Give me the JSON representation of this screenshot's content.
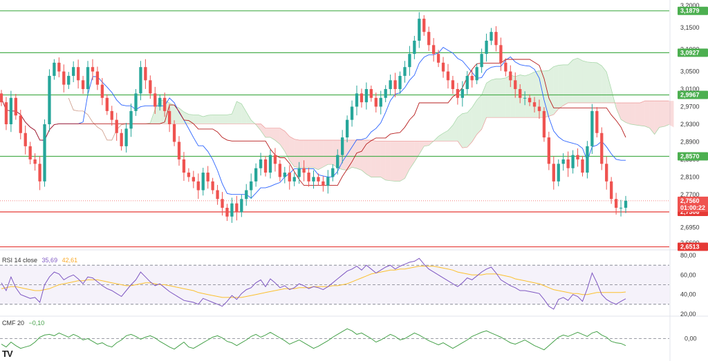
{
  "chart_data": [
    {
      "type": "candlestick",
      "title": "",
      "ylim": [
        2.66,
        3.2
      ],
      "yaxis_ticks": [
        "3,2000",
        "3,1500",
        "3,1000",
        "3,0500",
        "3,0100",
        "2,9700",
        "2,9300",
        "2,8900",
        "2,8500",
        "2,8100",
        "2,7700",
        "2,7300",
        "2,6950",
        "2,6600"
      ],
      "yaxis_tick_values": [
        3.2,
        3.15,
        3.1,
        3.05,
        3.01,
        2.97,
        2.93,
        2.89,
        2.85,
        2.81,
        2.77,
        2.73,
        2.695,
        2.66
      ],
      "horizontal_levels": [
        {
          "value": 3.1879,
          "label": "3,1879",
          "color": "#4caf50"
        },
        {
          "value": 3.0927,
          "label": "3,0927",
          "color": "#4caf50"
        },
        {
          "value": 2.9967,
          "label": "2,9967",
          "color": "#4caf50"
        },
        {
          "value": 2.857,
          "label": "2,8570",
          "color": "#4caf50"
        },
        {
          "value": 2.7306,
          "label": "2,7306",
          "color": "#e53935"
        },
        {
          "value": 2.6513,
          "label": "2,6513",
          "color": "#e53935"
        }
      ],
      "current_price": {
        "value": 2.756,
        "label": "2,7560",
        "countdown": "01:00:22"
      },
      "colors": {
        "up": "#26a69a",
        "down": "#ef5350",
        "tenkan": "#2962ff",
        "kijun": "#b71c1c",
        "kumo_bull": "#a5d6a7",
        "kumo_bear": "#ef9a9a"
      },
      "closes": [
        2.98,
        2.93,
        2.99,
        2.95,
        2.91,
        2.88,
        2.85,
        2.84,
        2.8,
        2.93,
        3.04,
        3.07,
        3.05,
        3.02,
        3.04,
        3.06,
        3.03,
        3.01,
        3.06,
        3.05,
        3.02,
        2.99,
        2.96,
        2.94,
        2.91,
        2.88,
        2.92,
        2.96,
        3.0,
        3.06,
        3.03,
        3.0,
        2.97,
        2.99,
        2.96,
        2.93,
        2.89,
        2.85,
        2.82,
        2.81,
        2.8,
        2.78,
        2.82,
        2.8,
        2.78,
        2.76,
        2.74,
        2.72,
        2.75,
        2.73,
        2.76,
        2.78,
        2.8,
        2.83,
        2.85,
        2.82,
        2.86,
        2.84,
        2.81,
        2.82,
        2.8,
        2.81,
        2.83,
        2.82,
        2.8,
        2.81,
        2.8,
        2.79,
        2.81,
        2.83,
        2.86,
        2.9,
        2.94,
        2.97,
        3.0,
        2.98,
        3.01,
        2.99,
        2.97,
        2.99,
        3.01,
        3.03,
        3.01,
        3.04,
        3.06,
        3.09,
        3.12,
        3.17,
        3.14,
        3.11,
        3.09,
        3.07,
        3.05,
        3.03,
        3.01,
        2.99,
        3.01,
        3.04,
        3.03,
        3.06,
        3.09,
        3.12,
        3.14,
        3.11,
        3.07,
        3.05,
        3.03,
        3.01,
        2.99,
        2.99,
        2.98,
        2.97,
        2.96,
        2.9,
        2.84,
        2.8,
        2.84,
        2.85,
        2.83,
        2.86,
        2.85,
        2.82,
        2.88,
        2.96,
        2.91,
        2.84,
        2.8,
        2.76,
        2.74,
        2.74,
        2.756
      ],
      "rsi": {
        "label": "RSI 14 close",
        "value_label": "35,69",
        "ma_label": "42,61",
        "ylim": [
          20,
          80
        ],
        "ticks": [
          "80,00",
          "60,00",
          "40,00",
          "20,00"
        ],
        "tick_values": [
          80,
          60,
          40,
          20
        ],
        "bands": [
          70,
          50,
          30
        ],
        "values": [
          52,
          44,
          58,
          47,
          40,
          38,
          36,
          37,
          32,
          50,
          58,
          63,
          61,
          55,
          58,
          60,
          56,
          51,
          58,
          57,
          53,
          49,
          46,
          44,
          41,
          38,
          44,
          50,
          55,
          63,
          58,
          53,
          49,
          51,
          47,
          43,
          40,
          37,
          34,
          33,
          32,
          30,
          36,
          34,
          32,
          30,
          28,
          33,
          39,
          35,
          41,
          45,
          47,
          52,
          55,
          48,
          56,
          52,
          47,
          49,
          45,
          47,
          51,
          49,
          46,
          48,
          47,
          45,
          48,
          52,
          56,
          60,
          64,
          66,
          69,
          65,
          70,
          66,
          62,
          65,
          68,
          70,
          66,
          69,
          71,
          73,
          74,
          77,
          71,
          66,
          63,
          60,
          57,
          54,
          51,
          48,
          52,
          57,
          55,
          59,
          63,
          66,
          68,
          62,
          55,
          52,
          49,
          47,
          44,
          44,
          43,
          42,
          41,
          35,
          28,
          25,
          35,
          37,
          34,
          40,
          38,
          33,
          46,
          62,
          52,
          40,
          35,
          32,
          30,
          33,
          35.69
        ],
        "ma": [
          46,
          47,
          48,
          48,
          47,
          46,
          45,
          44,
          44,
          45,
          46,
          48,
          50,
          51,
          52,
          53,
          54,
          54,
          55,
          55,
          55,
          54,
          53,
          52,
          51,
          50,
          49,
          49,
          50,
          51,
          52,
          52,
          51,
          50,
          50,
          49,
          48,
          47,
          46,
          45,
          44,
          42,
          41,
          40,
          39,
          38,
          37,
          37,
          37,
          37,
          37,
          38,
          39,
          40,
          41,
          42,
          43,
          44,
          45,
          46,
          46,
          46,
          47,
          47,
          47,
          48,
          48,
          48,
          48,
          49,
          49,
          50,
          51,
          53,
          55,
          57,
          59,
          61,
          62,
          63,
          64,
          65,
          65,
          66,
          66,
          67,
          68,
          69,
          69,
          69,
          69,
          68,
          67,
          66,
          65,
          63,
          62,
          61,
          60,
          60,
          60,
          61,
          61,
          61,
          60,
          59,
          58,
          56,
          55,
          54,
          53,
          52,
          51,
          49,
          47,
          45,
          44,
          43,
          42,
          41,
          41,
          40,
          40,
          41,
          42,
          42,
          42,
          42,
          42,
          42,
          42.61
        ]
      },
      "cmf": {
        "label": "CMF 20",
        "value_label": "−0,10",
        "ylim": [
          -0.3,
          0.3
        ],
        "ticks": [
          "0,00"
        ],
        "tick_values": [
          0
        ],
        "values": [
          -0.08,
          -0.12,
          -0.05,
          -0.1,
          -0.14,
          -0.12,
          -0.1,
          -0.05,
          0.02,
          0.05,
          0.06,
          0.04,
          0.08,
          0.05,
          0.02,
          0.06,
          0.03,
          -0.02,
          0.0,
          -0.04,
          -0.08,
          -0.06,
          -0.1,
          -0.12,
          -0.06,
          -0.02,
          0.04,
          0.06,
          0.03,
          -0.01,
          0.02,
          0.04,
          0.01,
          -0.04,
          -0.08,
          -0.12,
          -0.15,
          -0.1,
          -0.05,
          -0.12,
          -0.14,
          -0.1,
          -0.06,
          -0.02,
          0.02,
          0.04,
          0.01,
          -0.04,
          -0.06,
          -0.1,
          -0.06,
          -0.02,
          0.03,
          0.06,
          0.02,
          0.05,
          0.09,
          0.05,
          0.01,
          -0.03,
          -0.08,
          -0.05,
          -0.02,
          -0.06,
          -0.1,
          -0.14,
          -0.11,
          -0.07,
          -0.03,
          0.02,
          0.06,
          0.1,
          0.14,
          0.11,
          0.06,
          0.08,
          0.04,
          0.0,
          -0.05,
          -0.02,
          0.02,
          0.06,
          0.03,
          -0.02,
          0.0,
          0.04,
          0.08,
          0.05,
          0.01,
          -0.03,
          -0.06,
          -0.09,
          -0.06,
          -0.1,
          -0.14,
          -0.1,
          -0.06,
          -0.02,
          0.03,
          0.06,
          0.09,
          0.11,
          0.08,
          0.05,
          0.02,
          -0.02,
          -0.06,
          -0.08,
          -0.05,
          -0.02,
          -0.06,
          -0.1,
          -0.13,
          -0.16,
          -0.1,
          -0.04,
          0.02,
          0.05,
          0.03,
          0.06,
          0.09,
          0.06,
          0.03,
          0.08,
          0.1,
          0.05,
          0.02,
          -0.04,
          -0.06,
          -0.07,
          -0.1
        ]
      }
    }
  ]
}
